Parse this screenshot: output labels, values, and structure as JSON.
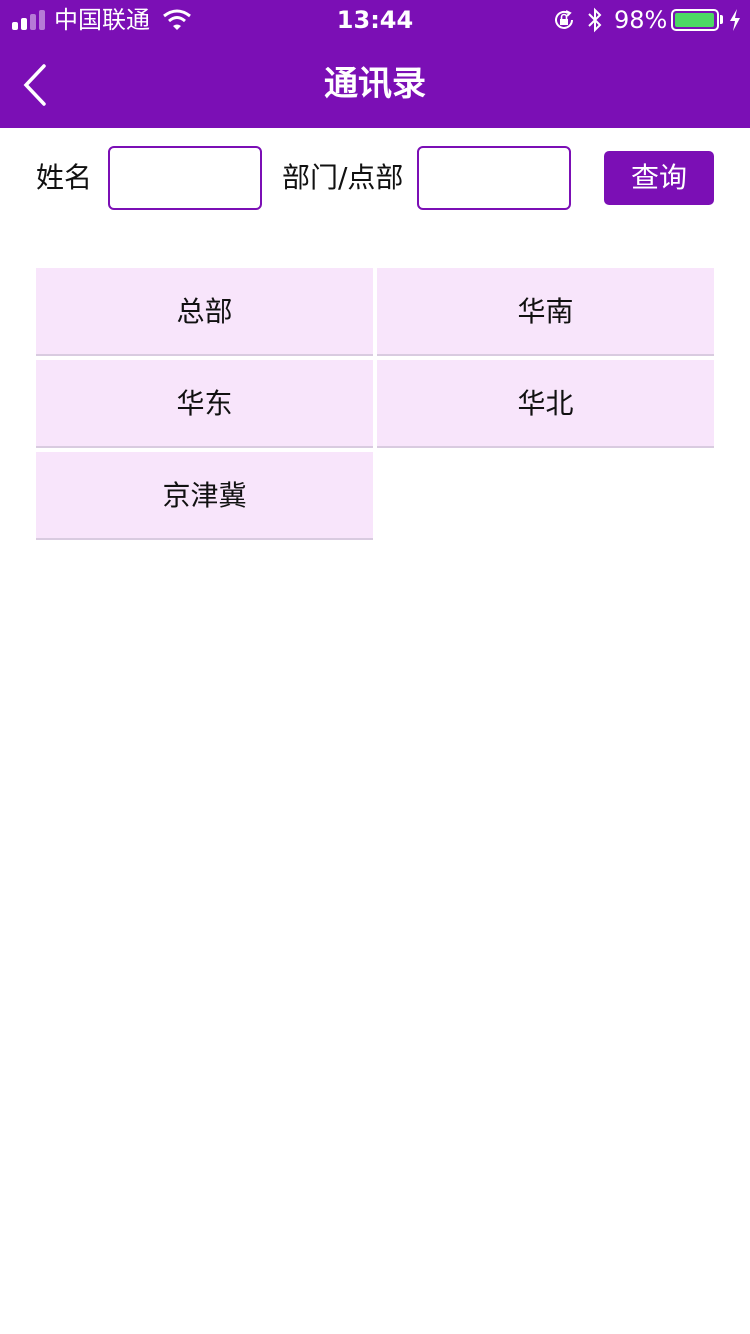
{
  "status_bar": {
    "carrier": "中国联通",
    "time": "13:44",
    "battery_percent": "98%",
    "battery_level": 0.98,
    "icons": [
      "signal-icon",
      "wifi-icon",
      "rotation-lock-icon",
      "bluetooth-icon",
      "battery-icon",
      "charging-icon"
    ]
  },
  "nav": {
    "title": "通讯录",
    "back_icon": "chevron-left-icon"
  },
  "search": {
    "name_label": "姓名",
    "name_value": "",
    "dept_label": "部门/点部",
    "dept_value": "",
    "query_label": "查询"
  },
  "departments": [
    {
      "label": "总部"
    },
    {
      "label": "华南"
    },
    {
      "label": "华东"
    },
    {
      "label": "华北"
    },
    {
      "label": "京津冀"
    }
  ],
  "colors": {
    "primary": "#7b0fb5",
    "cell_bg": "#f8e5fb",
    "battery_fill": "#4cd964"
  }
}
